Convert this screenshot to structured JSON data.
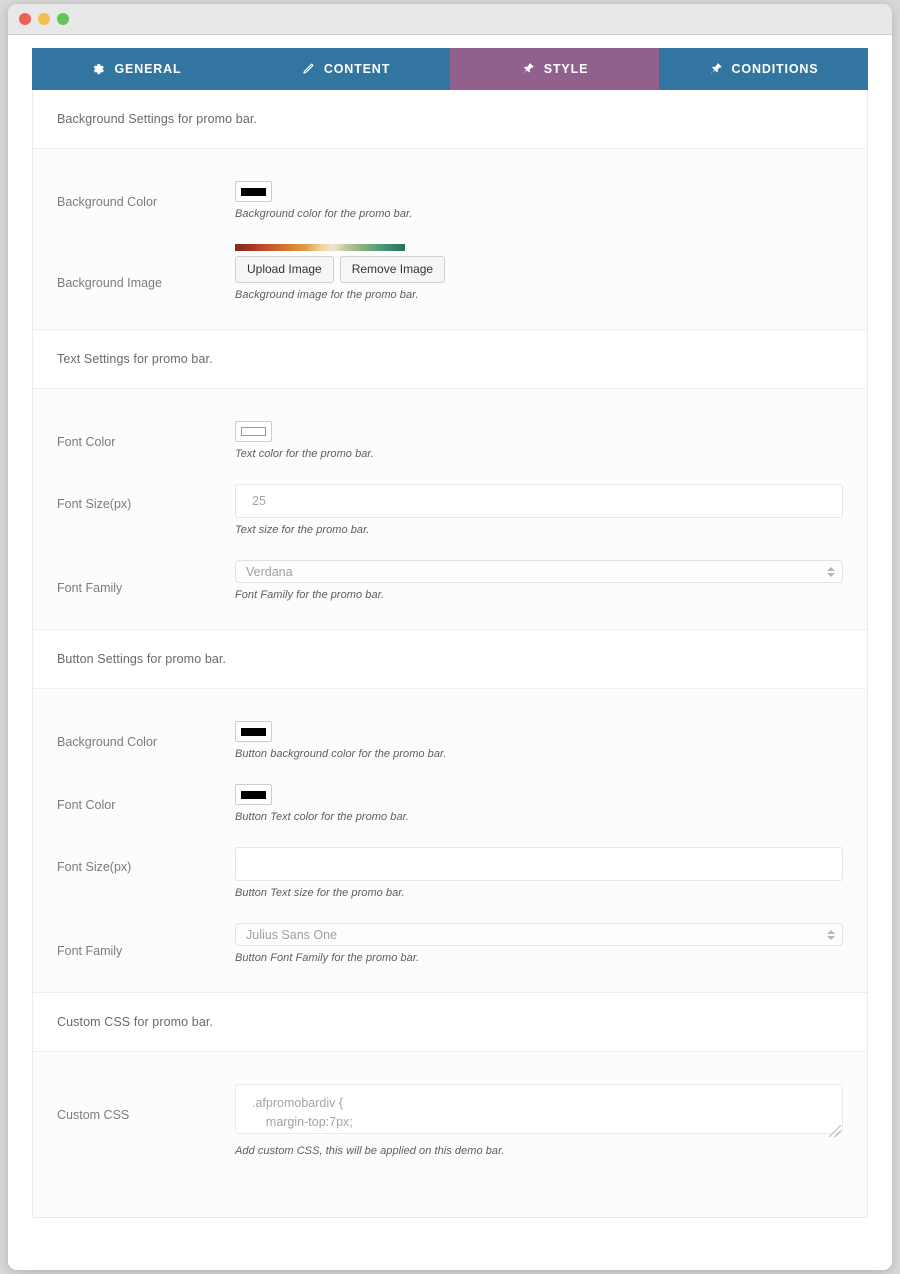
{
  "window": {
    "traffic_lights": [
      "close",
      "minimize",
      "zoom"
    ]
  },
  "tabs": [
    {
      "label": "GENERAL",
      "icon": "gear-icon",
      "active": false
    },
    {
      "label": "CONTENT",
      "icon": "pencil-icon",
      "active": false
    },
    {
      "label": "STYLE",
      "icon": "pin-icon",
      "active": true
    },
    {
      "label": "CONDITIONS",
      "icon": "pin-icon",
      "active": false
    }
  ],
  "colors": {
    "tab_inactive": "#3175a0",
    "tab_active": "#90618c",
    "swatch_black": "#000000",
    "swatch_white": "#ffffff"
  },
  "sections": {
    "background": {
      "heading": "Background Settings for promo bar.",
      "bg_color": {
        "label": "Background Color",
        "help": "Background color for the promo bar.",
        "value": "#000000"
      },
      "bg_image": {
        "label": "Background Image",
        "help": "Background image for the promo bar.",
        "upload_label": "Upload Image",
        "remove_label": "Remove Image"
      }
    },
    "text": {
      "heading": "Text Settings for promo bar.",
      "font_color": {
        "label": "Font Color",
        "help": "Text color for the promo bar.",
        "value": "#ffffff"
      },
      "font_size": {
        "label": "Font Size(px)",
        "help": "Text size for the promo bar.",
        "placeholder": "25",
        "value": ""
      },
      "font_family": {
        "label": "Font Family",
        "help": "Font Family for the promo bar.",
        "selected": "Verdana"
      }
    },
    "button": {
      "heading": "Button Settings for promo bar.",
      "bg_color": {
        "label": "Background Color",
        "help": "Button background color for the promo bar.",
        "value": "#000000"
      },
      "font_color": {
        "label": "Font Color",
        "help": "Button Text color for the promo bar.",
        "value": "#000000"
      },
      "font_size": {
        "label": "Font Size(px)",
        "help": "Button Text size for the promo bar.",
        "placeholder": "",
        "value": ""
      },
      "font_family": {
        "label": "Font Family",
        "help": "Button Font Family for the promo bar.",
        "selected": "Julius Sans One"
      }
    },
    "custom_css": {
      "heading": "Custom CSS for promo bar.",
      "field": {
        "label": "Custom CSS",
        "help": "Add custom CSS, this will be applied on this demo bar.",
        "placeholder": ".afpromobardiv {\n    margin-top:7px;",
        "value": ""
      }
    }
  }
}
